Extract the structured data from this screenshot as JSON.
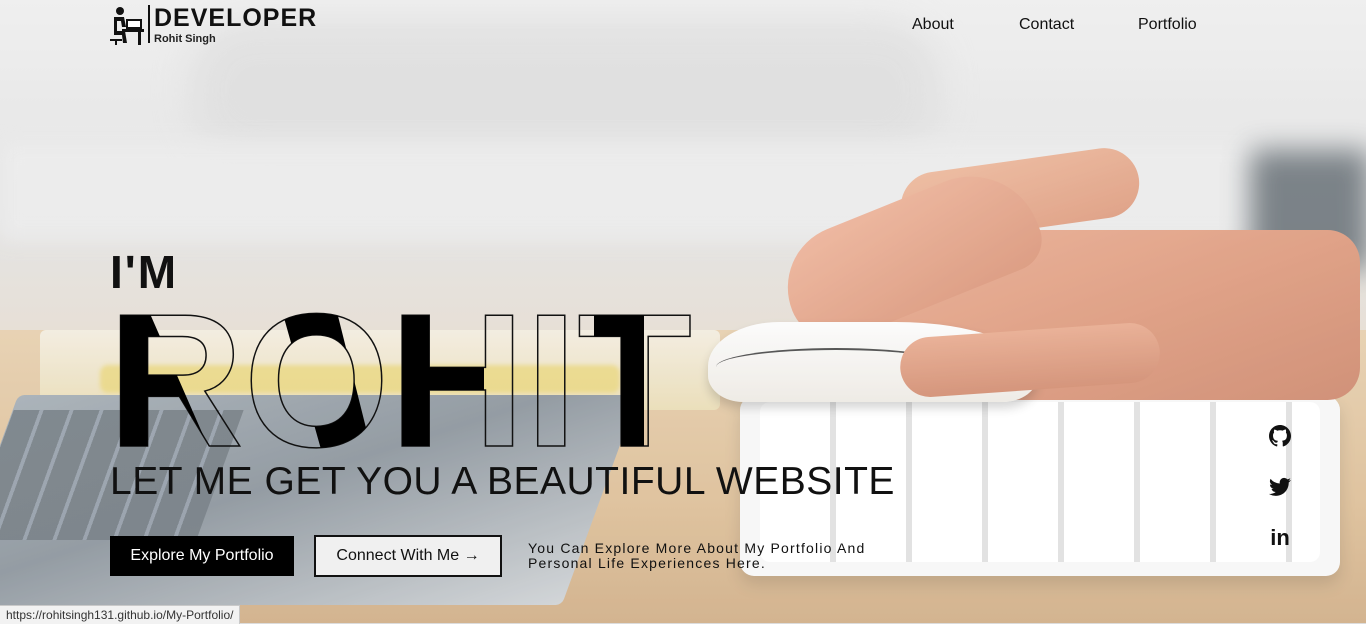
{
  "header": {
    "logo_title": "DEVELOPER",
    "logo_subtitle": "Rohit Singh",
    "nav": [
      {
        "label": "About"
      },
      {
        "label": "Contact"
      },
      {
        "label": "Portfolio"
      }
    ]
  },
  "hero": {
    "intro": "I'M",
    "name": "ROHIT",
    "tagline": "LET ME GET YOU A BEAUTIFUL WEBSITE",
    "primary_button": "Explore My Portfolio",
    "secondary_button": "Connect With Me →",
    "description": "You Can Explore More About My Portfolio And Personal Life Experiences Here."
  },
  "social": [
    {
      "icon": "github-icon"
    },
    {
      "icon": "twitter-icon"
    },
    {
      "icon": "linkedin-icon",
      "label": "in"
    }
  ],
  "status_bar": {
    "url": "https://rohitsingh131.github.io/My-Portfolio/"
  },
  "colors": {
    "text": "#111111",
    "button_primary_bg": "#000000",
    "button_primary_text": "#ffffff"
  }
}
